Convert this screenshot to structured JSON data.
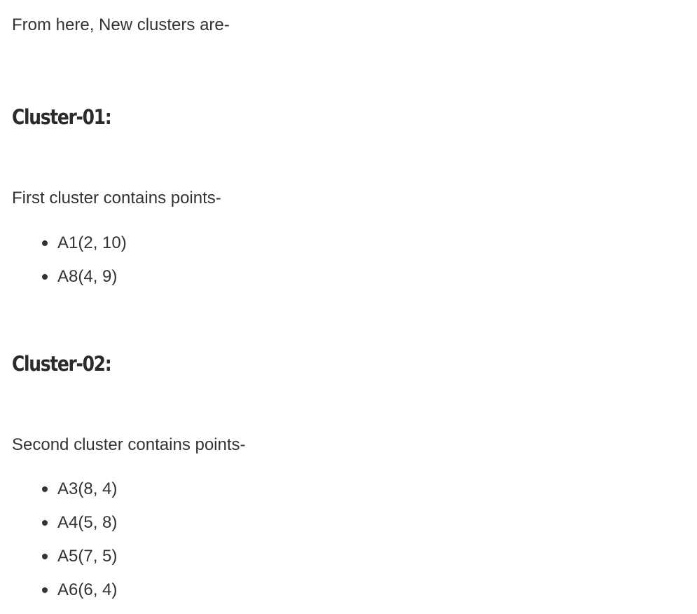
{
  "intro": {
    "text": "From here, New clusters are-"
  },
  "cluster1": {
    "heading": "Cluster-01:",
    "description": "First cluster contains points-",
    "points": [
      "A1(2, 10)",
      "A8(4, 9)"
    ]
  },
  "cluster2": {
    "heading": "Cluster-02:",
    "description": "Second cluster contains points-",
    "points": [
      "A3(8, 4)",
      "A4(5, 8)",
      "A5(7, 5)",
      "A6(6, 4)"
    ]
  }
}
